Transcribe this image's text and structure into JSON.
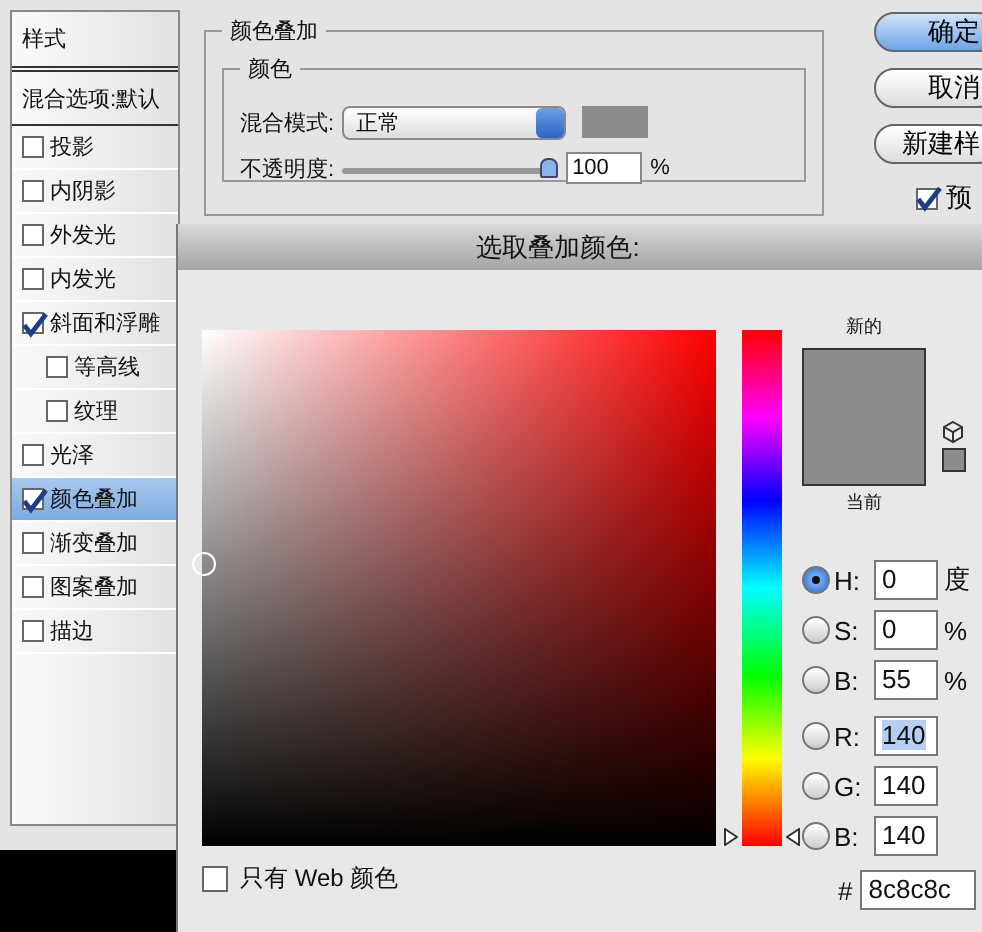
{
  "styles_panel": {
    "header": "样式",
    "blend_default": "混合选项:默认",
    "items": [
      {
        "label": "投影",
        "checked": false,
        "selected": false
      },
      {
        "label": "内阴影",
        "checked": false,
        "selected": false
      },
      {
        "label": "外发光",
        "checked": false,
        "selected": false
      },
      {
        "label": "内发光",
        "checked": false,
        "selected": false
      },
      {
        "label": "斜面和浮雕",
        "checked": true,
        "selected": false,
        "children": [
          {
            "label": "等高线",
            "checked": false,
            "selected": false
          },
          {
            "label": "纹理",
            "checked": false,
            "selected": false
          }
        ]
      },
      {
        "label": "光泽",
        "checked": false,
        "selected": false
      },
      {
        "label": "颜色叠加",
        "checked": true,
        "selected": true
      },
      {
        "label": "渐变叠加",
        "checked": false,
        "selected": false
      },
      {
        "label": "图案叠加",
        "checked": false,
        "selected": false
      },
      {
        "label": "描边",
        "checked": false,
        "selected": false
      }
    ]
  },
  "color_overlay": {
    "title": "颜色叠加",
    "group": "颜色",
    "blend_mode_label": "混合模式:",
    "blend_mode": "正常",
    "opacity_label": "不透明度:",
    "opacity": {
      "level": 1
    },
    "opacity_value": "100",
    "opacity_unit": "%"
  },
  "buttons": [
    {
      "label": "确定",
      "default": true
    },
    {
      "label": "取消",
      "default": false
    },
    {
      "label": "新建样",
      "default": false
    }
  ],
  "preview": {
    "label": "预",
    "checked": true
  },
  "picker": {
    "title": "选取叠加颜色:",
    "hue_slider": {
      "level": 0
    },
    "new_label": "新的",
    "current_label": "当前",
    "web_only": {
      "label": "只有 Web 颜色",
      "checked": false
    },
    "fields": [
      {
        "label": "H:",
        "value": "0",
        "unit": "度",
        "selected": true,
        "highlighted": false
      },
      {
        "label": "S:",
        "value": "0",
        "unit": "%",
        "selected": false,
        "highlighted": false
      },
      {
        "label": "B:",
        "value": "55",
        "unit": "%",
        "selected": false,
        "highlighted": false
      },
      {
        "label": "R:",
        "value": "140",
        "selected": false,
        "highlighted": true
      },
      {
        "label": "G:",
        "value": "140",
        "selected": false,
        "highlighted": false
      },
      {
        "label": "B:",
        "value": "140",
        "selected": false,
        "highlighted": false
      }
    ],
    "hex_label": "#",
    "hex": "8c8c8c"
  }
}
